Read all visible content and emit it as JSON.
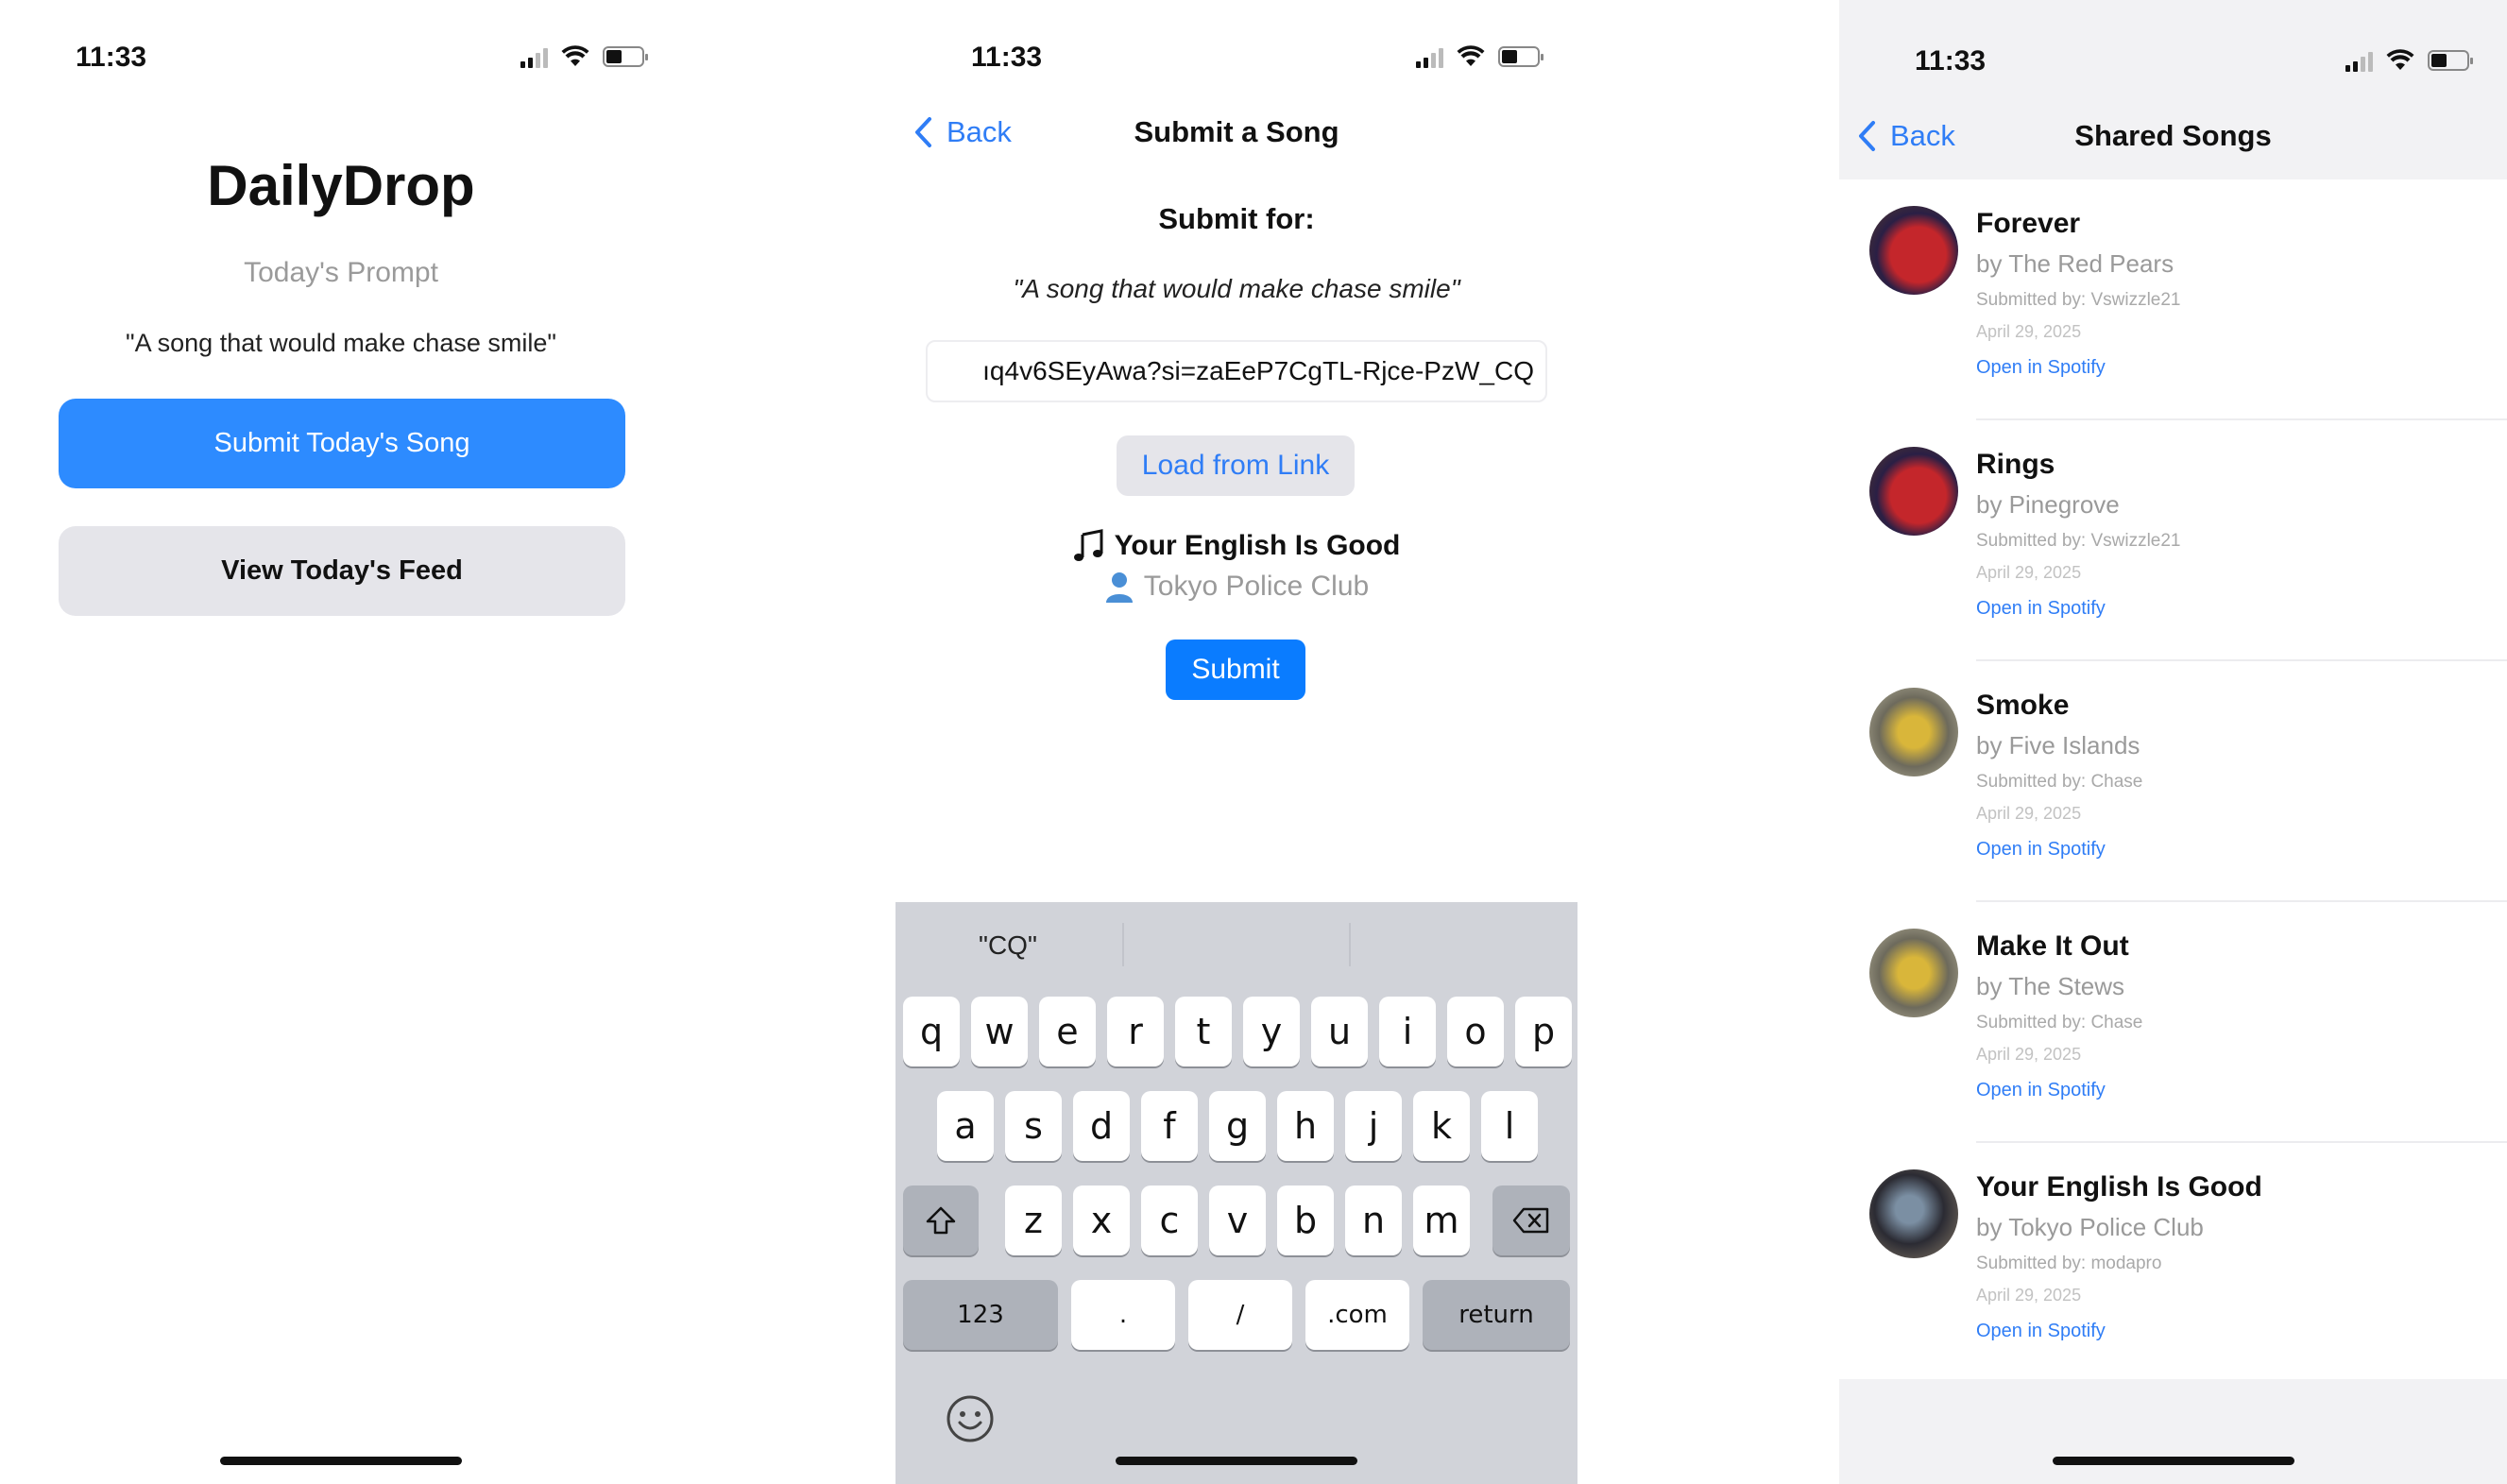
{
  "status": {
    "time": "11:33"
  },
  "home": {
    "app_title": "DailyDrop",
    "prompt_label": "Today's Prompt",
    "prompt_text": "\"A song that would make chase smile\"",
    "submit_button": "Submit Today's Song",
    "feed_button": "View Today's Feed"
  },
  "submit": {
    "back_label": "Back",
    "nav_title": "Submit a Song",
    "submit_for": "Submit for:",
    "prompt": "\"A song that would make chase smile\"",
    "link_value": "ıq4v6SEyAwa?si=zaEeP7CgTL-Rjce-PzW_CQ",
    "load_button": "Load from Link",
    "song_title": "Your English Is Good",
    "song_artist": "Tokyo Police Club",
    "submit_button": "Submit",
    "icons": {
      "title": "music-note-icon",
      "artist": "person-icon"
    }
  },
  "keyboard": {
    "suggestion": "\"CQ\"",
    "row1": [
      "q",
      "w",
      "e",
      "r",
      "t",
      "y",
      "u",
      "i",
      "o",
      "p"
    ],
    "row2": [
      "a",
      "s",
      "d",
      "f",
      "g",
      "h",
      "j",
      "k",
      "l"
    ],
    "row3": [
      "z",
      "x",
      "c",
      "v",
      "b",
      "n",
      "m"
    ],
    "numbers": "123",
    "dot": ".",
    "slash": "/",
    "dotcom": ".com",
    "return": "return"
  },
  "feed": {
    "back_label": "Back",
    "nav_title": "Shared Songs",
    "songs": [
      {
        "title": "Forever",
        "artist": "by The Red Pears",
        "submitted": "Submitted by: Vswizzle21",
        "date": "April 29, 2025",
        "open": "Open in Spotify"
      },
      {
        "title": "Rings",
        "artist": "by Pinegrove",
        "submitted": "Submitted by: Vswizzle21",
        "date": "April 29, 2025",
        "open": "Open in Spotify"
      },
      {
        "title": "Smoke",
        "artist": "by Five Islands",
        "submitted": "Submitted by: Chase",
        "date": "April 29, 2025",
        "open": "Open in Spotify"
      },
      {
        "title": "Make It Out",
        "artist": "by The Stews",
        "submitted": "Submitted by: Chase",
        "date": "April 29, 2025",
        "open": "Open in Spotify"
      },
      {
        "title": "Your English Is Good",
        "artist": "by Tokyo Police Club",
        "submitted": "Submitted by: modapro",
        "date": "April 29, 2025",
        "open": "Open in Spotify"
      }
    ]
  },
  "colors": {
    "accent": "#2f7df6",
    "primary_button": "#2d8bff",
    "secondary_button": "#e5e5ea",
    "keyboard_bg": "#d1d3d9"
  }
}
